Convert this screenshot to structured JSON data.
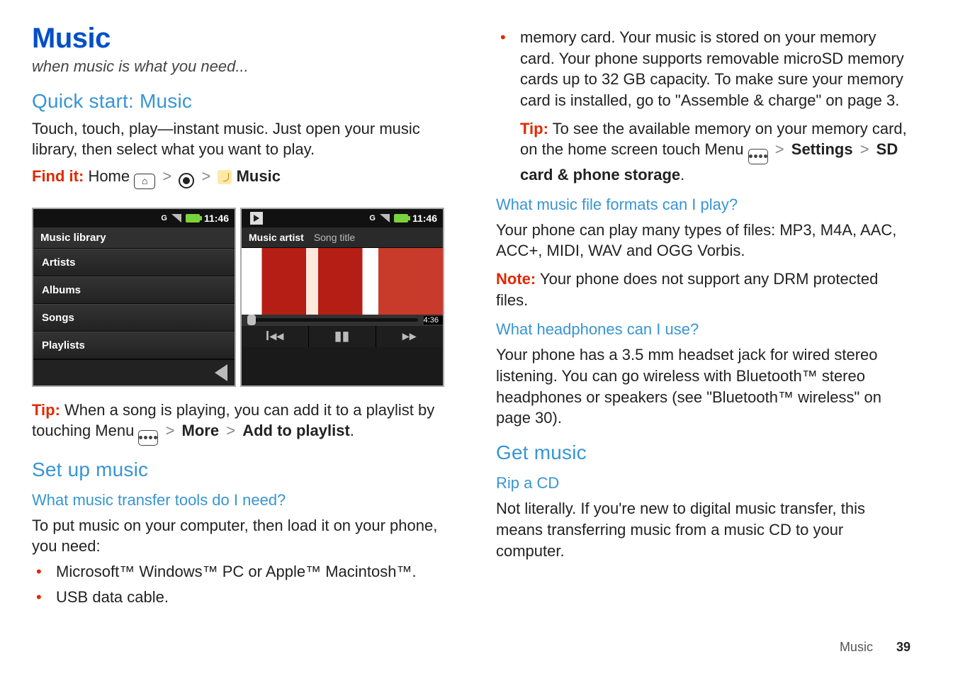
{
  "left": {
    "h1": "Music",
    "tagline": "when music is what you need...",
    "quickstart": {
      "h2": "Quick start: Music",
      "p": "Touch, touch, play—instant music. Just open your music library, then select what you want to play.",
      "findit_label": "Find it:",
      "findit_home": "Home",
      "findit_music": "Music"
    },
    "screens": {
      "time": "11:46",
      "g": "G",
      "library_header": "Music library",
      "rows": [
        "Artists",
        "Albums",
        "Songs",
        "Playlists"
      ],
      "now_artist": "Music artist",
      "now_title": "Song title",
      "duration": "4:36",
      "ctrl_prev": "I◂◂",
      "ctrl_pause": "▮▮",
      "ctrl_next": "▸▸"
    },
    "tip": {
      "label": "Tip:",
      "before": " When a song is playing, you can add it to a playlist by touching Menu ",
      "more": "More",
      "add": "Add to playlist",
      "dot": "."
    },
    "setup": {
      "h2": "Set up music",
      "h3": "What music transfer tools do I need?",
      "p": "To put music on your computer, then load it on your phone, you need:",
      "items": [
        "Microsoft™ Windows™ PC or Apple™ Macintosh™.",
        "USB data cable."
      ]
    }
  },
  "right": {
    "memcard": "memory card. Your music is stored on your memory card. Your phone supports removable microSD memory cards up to 32 GB capacity. To make sure your memory card is installed, go to \"Assemble & charge\" on page 3.",
    "tip": {
      "label": "Tip:",
      "before": " To see the available memory on your memory card, on the home screen touch Menu ",
      "settings": "Settings",
      "sd": "SD card & phone storage",
      "dot": "."
    },
    "formats": {
      "h3": "What music file formats can I play?",
      "p": "Your phone can play many types of files: MP3, M4A, AAC, ACC+, MIDI, WAV and OGG Vorbis.",
      "note_label": "Note:",
      "note_body": " Your phone does not support any DRM protected files."
    },
    "headphones": {
      "h3": "What headphones can I use?",
      "p": "Your phone has a 3.5 mm headset jack for wired stereo listening. You can go wireless with Bluetooth™ stereo headphones or speakers (see \"Bluetooth™ wireless\" on page 30)."
    },
    "get": {
      "h2": "Get music"
    },
    "rip": {
      "h3": "Rip a CD",
      "p": "Not literally. If you're new to digital music transfer, this means transferring music from a music CD to your computer."
    }
  },
  "footer": {
    "section": "Music",
    "page": "39"
  }
}
